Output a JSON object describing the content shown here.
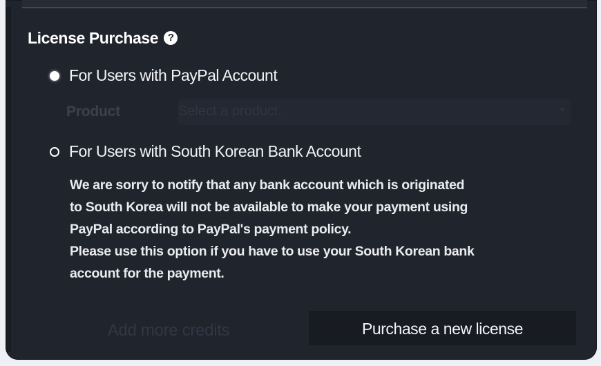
{
  "license_purchase": {
    "heading": "License Purchase",
    "help_icon": "?",
    "paypal_option": {
      "label": "For Users with PayPal Account",
      "selected": true
    },
    "product": {
      "label": "Product",
      "placeholder": "Select a product.",
      "dropdown_icon": "chevron-down-icon"
    },
    "korea_option": {
      "label": "For Users with South Korean Bank Account",
      "selected": false
    },
    "notice_lines": [
      "We are sorry to notify that any bank account which is originated",
      "to South Korea will not be available to make your payment using",
      "PayPal according to PayPal's payment policy.",
      "Please use this option if you have to use your South Korean bank",
      "account for the payment."
    ]
  },
  "actions": {
    "add_credits_label": "Add more credits",
    "purchase_label": "Purchase a new license"
  },
  "colors": {
    "background": "#20242d",
    "text": "#ffffff",
    "disabled_text": "#313744",
    "button_background": "#181b22"
  }
}
